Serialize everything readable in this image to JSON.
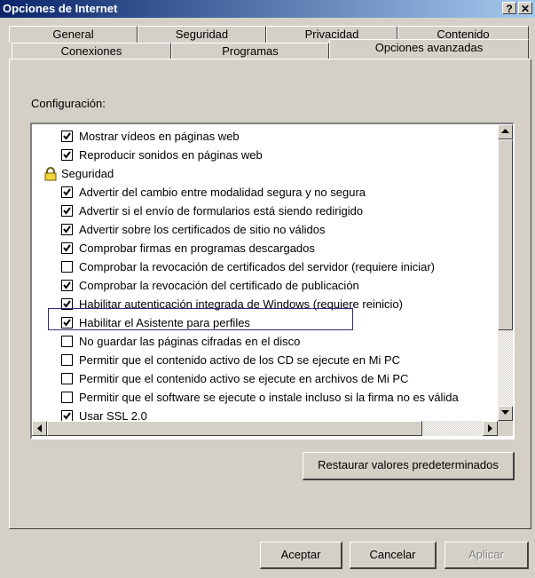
{
  "window": {
    "title": "Opciones de Internet",
    "help_label": "?",
    "close_label": "✕"
  },
  "tabs": {
    "row1": [
      "General",
      "Seguridad",
      "Privacidad",
      "Contenido"
    ],
    "row2": [
      "Conexiones",
      "Programas",
      "Opciones avanzadas"
    ],
    "selected": "Opciones avanzadas"
  },
  "settings": {
    "label": "Configuración:",
    "items": [
      {
        "label": "Mostrar vídeos en páginas web",
        "type": "checkbox",
        "checked": true
      },
      {
        "label": "Reproducir sonidos en páginas web",
        "type": "checkbox",
        "checked": true
      },
      {
        "label": "Seguridad",
        "type": "group",
        "icon": "lock-icon"
      },
      {
        "label": "Advertir del cambio entre modalidad segura y no segura",
        "type": "checkbox",
        "checked": true
      },
      {
        "label": "Advertir si el envío de formularios está siendo redirigido",
        "type": "checkbox",
        "checked": true
      },
      {
        "label": "Advertir sobre los certificados de sitio no válidos",
        "type": "checkbox",
        "checked": true
      },
      {
        "label": "Comprobar firmas en programas descargados",
        "type": "checkbox",
        "checked": true
      },
      {
        "label": "Comprobar la revocación de certificados del servidor (requiere iniciar)",
        "type": "checkbox",
        "checked": false
      },
      {
        "label": "Comprobar la revocación del certificado de publicación",
        "type": "checkbox",
        "checked": true
      },
      {
        "label": "Habilitar autenticación integrada de Windows (requiere reinicio)",
        "type": "checkbox",
        "checked": true
      },
      {
        "label": "Habilitar el Asistente para perfiles",
        "type": "checkbox",
        "checked": true,
        "focused": true
      },
      {
        "label": "No guardar las páginas cifradas en el disco",
        "type": "checkbox",
        "checked": false
      },
      {
        "label": "Permitir que el contenido activo de los CD se ejecute en Mi PC",
        "type": "checkbox",
        "checked": false
      },
      {
        "label": "Permitir que el contenido activo se ejecute en archivos de Mi PC",
        "type": "checkbox",
        "checked": false
      },
      {
        "label": "Permitir que el software se ejecute o instale incluso si la firma no es válida",
        "type": "checkbox",
        "checked": false
      },
      {
        "label": "Usar SSL 2.0",
        "type": "checkbox",
        "checked": true
      }
    ]
  },
  "buttons": {
    "restore": "Restaurar valores predeterminados",
    "ok": "Aceptar",
    "cancel": "Cancelar",
    "apply": "Aplicar"
  }
}
